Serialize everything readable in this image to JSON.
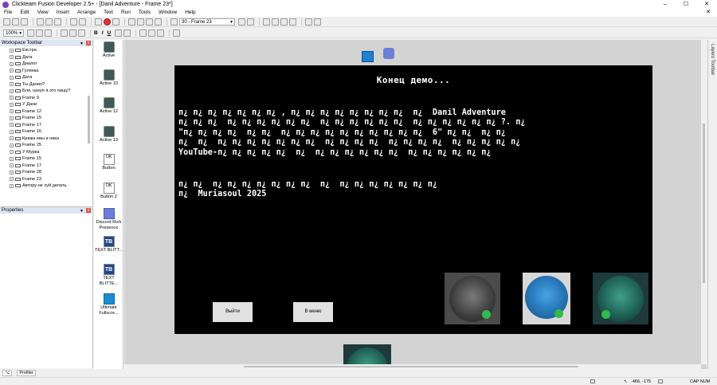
{
  "window": {
    "title": "Clickteam Fusion Developer 2.5+ - [Danil Adventure - Frame 23*]",
    "buttons": [
      "–",
      "☐",
      "✕"
    ]
  },
  "menu": {
    "items": [
      "File",
      "Edit",
      "View",
      "Insert",
      "Arrange",
      "Text",
      "Run",
      "Tools",
      "Window",
      "Help"
    ],
    "close_glyph": "✕"
  },
  "toolbar": {
    "frame_select": "30 - Frame 23",
    "zoom": "100%",
    "format_letters": [
      "B",
      "I",
      "U"
    ]
  },
  "workspace": {
    "header": "Workspace Toolbar",
    "items": [
      "Екстра",
      "Дата",
      "Диалог",
      "Гулянка",
      "Дата",
      "Ты Данил?",
      "Бля, нахуя я это пишу?",
      "Frame 9",
      "У Дани",
      "Frame 12",
      "Frame 15",
      "Frame 17",
      "Frame 16",
      "Кража евы и ника",
      "Frame 25",
      "У Мурка",
      "Frame 15",
      "Frame 17",
      "Frame 28",
      "Frame 23",
      "Автору не хуй делать"
    ]
  },
  "properties": {
    "header": "Properties"
  },
  "bottom_tabs": [
    "Profiler"
  ],
  "objects": [
    {
      "label": "Active",
      "kind": "active"
    },
    {
      "label": "Active 10",
      "kind": "active"
    },
    {
      "label": "Active 12",
      "kind": "active"
    },
    {
      "label": "Active 13",
      "kind": "active"
    },
    {
      "label": "Button",
      "kind": "button"
    },
    {
      "label": "Button 2",
      "kind": "button"
    },
    {
      "label": "Discord Rich Presence",
      "kind": "discord"
    },
    {
      "label": "TEXT BLITT...",
      "kind": "text"
    },
    {
      "label": "TEXT BLITTE...",
      "kind": "text"
    },
    {
      "label": "Ultimate Fullscre...",
      "kind": "ultimate"
    }
  ],
  "frame": {
    "title": "Конец демо...",
    "text_block_1": "п¿ п¿ п¿ п¿ п¿ п¿ п¿ , п¿ п¿ п¿ п¿ п¿ п¿ п¿ п¿  п¿  Danil Adventure\nп¿ п¿ п¿  п¿ п¿ п¿ п¿ п¿ п¿  п¿ п¿ п¿ п¿ п¿ п¿  п¿ п¿ п¿ п¿ п¿ п¿ ?. п¿\n\"п¿ п¿ п¿ п¿  п¿ п¿  п¿ п¿ п¿ п¿ п¿ п¿ п¿ п¿ п¿ п¿  6\" п¿ п¿  п¿ п¿\nп¿  п¿  п¿ п¿ п¿ п¿ п¿ п¿ п¿  п¿ п¿ п¿ п¿  п¿ п¿ п¿ п¿  п¿ п¿ п¿ п¿ п¿\nYouTube-п¿ п¿ п¿ п¿ п¿  п¿  п¿ п¿ п¿ п¿ п¿ п¿  п¿ п¿ п¿ п¿ п¿ п¿",
    "text_block_2": "п¿ п¿  п¿ п¿ п¿ п¿ п¿ п¿ п¿  п¿  п¿ п¿ п¿ п¿ п¿ п¿ п¿\nп¿  Muriasoul 2025",
    "exit_button": "Выйти",
    "menu_button": "В меню"
  },
  "layers_label": "Layers Toolbar",
  "status": {
    "coords": "-466, -175",
    "keys": "CAP NUM"
  }
}
